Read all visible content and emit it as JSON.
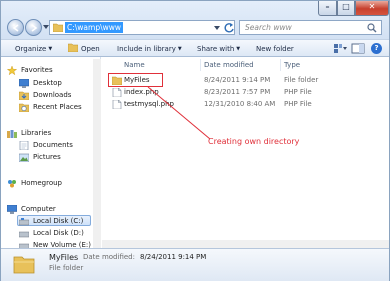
{
  "address": {
    "path": "C:\\wamp\\www"
  },
  "search": {
    "placeholder": "Search www"
  },
  "toolbar": {
    "organize": "Organize",
    "open": "Open",
    "include": "Include in library",
    "share": "Share with",
    "new_folder": "New folder"
  },
  "nav": {
    "favorites": "Favorites",
    "desktop": "Desktop",
    "downloads": "Downloads",
    "recent": "Recent Places",
    "libraries": "Libraries",
    "documents": "Documents",
    "pictures": "Pictures",
    "homegroup": "Homegroup",
    "computer": "Computer",
    "disk_c": "Local Disk (C:)",
    "disk_d": "Local Disk (D:)",
    "new_volume": "New Volume (E:)"
  },
  "columns": {
    "name": "Name",
    "date": "Date modified",
    "type": "Type"
  },
  "files": [
    {
      "name": "MyFiles",
      "date": "8/24/2011 9:14 PM",
      "type": "File folder",
      "icon": "folder-icon"
    },
    {
      "name": "index.php",
      "date": "8/23/2011 7:57 PM",
      "type": "PHP File",
      "icon": "php-file-icon"
    },
    {
      "name": "testmysql.php",
      "date": "12/31/2010 8:40 AM",
      "type": "PHP File",
      "icon": "php-file-icon"
    }
  ],
  "annotation": "Creating own directory",
  "details": {
    "name": "MyFiles",
    "modified_label": "Date modified:",
    "modified_value": "8/24/2011 9:14 PM",
    "type": "File folder"
  },
  "colors": {
    "annotation": "#e0303a",
    "selection": "#3399ff"
  }
}
